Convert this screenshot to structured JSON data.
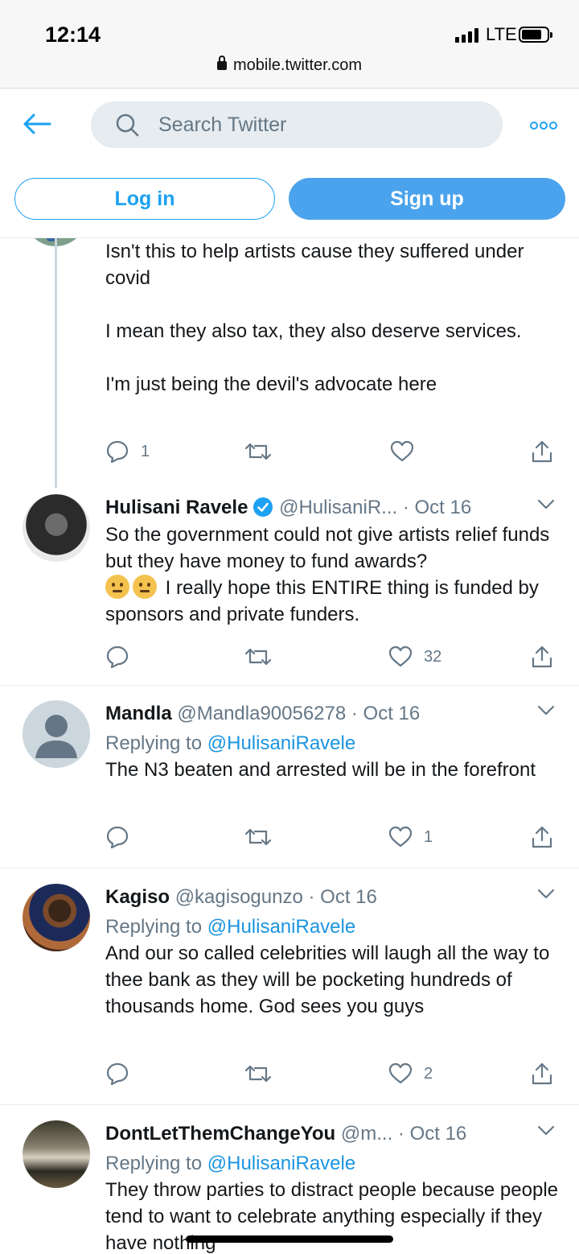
{
  "status_bar": {
    "time": "12:14",
    "network": "LTE",
    "url": "mobile.twitter.com"
  },
  "header": {
    "search_placeholder": "Search Twitter",
    "login_label": "Log in",
    "signup_label": "Sign up"
  },
  "colors": {
    "accent": "#1da1f2",
    "signup_bg": "#4aa3ec",
    "muted": "#657786"
  },
  "tweets": [
    {
      "body": "Isn't this to help artists cause they suffered under covid\n\nI mean they also tax, they also deserve services.\n\nI'm just being the devil's advocate here",
      "replies": "1",
      "likes": ""
    },
    {
      "name": "Hulisani Ravele",
      "verified": true,
      "handle": "@HulisaniR...",
      "date": "· Oct 16",
      "body_before_emoji": "So the government could not give artists relief funds but they have money to fund awards?",
      "body_after_emoji": " I really hope this ENTIRE thing is funded by sponsors and private funders.",
      "emojis": [
        "thinking-face-emoji",
        "face-with-raised-eyebrow-emoji"
      ],
      "likes": "32"
    },
    {
      "name": "Mandla",
      "handle": "@Mandla90056278",
      "date": "· Oct 16",
      "replying_label": "Replying to",
      "replying_to": "@HulisaniRavele",
      "body": "The N3 beaten and arrested will be in the forefront",
      "likes": "1"
    },
    {
      "name": "Kagiso",
      "handle": "@kagisogunzo",
      "date": "· Oct 16",
      "replying_label": "Replying to",
      "replying_to": "@HulisaniRavele",
      "body": "And our so called celebrities will laugh all the way to thee bank as they will be pocketing hundreds of thousands home. God sees you guys",
      "likes": "2"
    },
    {
      "name": "DontLetThemChangeYou",
      "handle": "@m...",
      "date": "· Oct 16",
      "replying_label": "Replying to",
      "replying_to": "@HulisaniRavele",
      "body": "They throw parties to distract people because people tend to want to celebrate anything especially if they have nothing"
    }
  ]
}
